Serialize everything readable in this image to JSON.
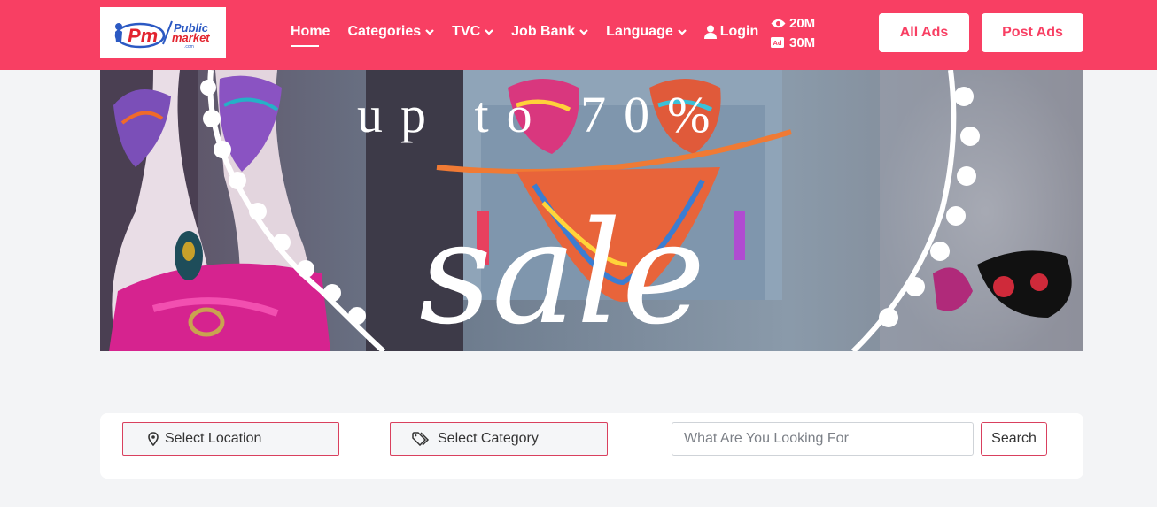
{
  "logo": {
    "primary": "Public",
    "secondary": "market",
    "suffix": ".com",
    "initials": "Pm"
  },
  "nav": {
    "items": [
      {
        "label": "Home",
        "active": true,
        "has_dropdown": false
      },
      {
        "label": "Categories",
        "has_dropdown": true
      },
      {
        "label": "TVC",
        "has_dropdown": true
      },
      {
        "label": "Job Bank",
        "has_dropdown": true
      },
      {
        "label": "Language",
        "has_dropdown": true
      }
    ],
    "login_label": "Login"
  },
  "stats": {
    "views": "20M",
    "ads": "30M",
    "ads_badge": "Ad"
  },
  "buttons": {
    "all_ads": "All Ads",
    "post_ads": "Post Ads"
  },
  "banner": {
    "headline": "up to 70%",
    "script_text": "sale"
  },
  "search": {
    "location_label": "Select Location",
    "category_label": "Select Category",
    "input_placeholder": "What Are You Looking For",
    "input_value": "",
    "button_label": "Search"
  },
  "colors": {
    "brand": "#f83f63",
    "background": "#f3f4f6",
    "border_accent": "#d9405e"
  },
  "icons": {
    "views": "eye-icon",
    "ads": "ad-badge-icon",
    "login": "user-icon",
    "location": "map-pin-icon",
    "category": "tags-icon",
    "dropdown": "chevron-down-icon"
  }
}
